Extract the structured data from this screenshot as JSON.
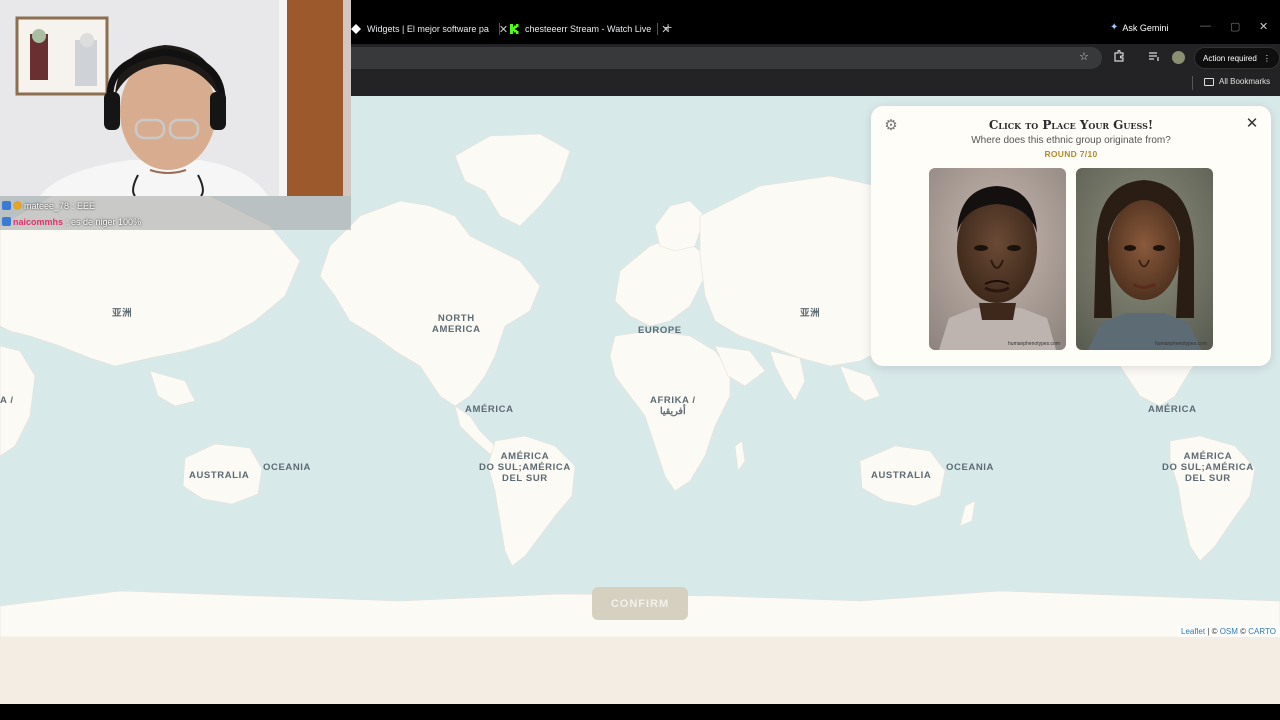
{
  "browser": {
    "tabs": [
      {
        "title": "Widgets | El mejor software pa",
        "favicon": "widgets-icon"
      },
      {
        "title": "chesteeerr Stream - Watch Live",
        "favicon": "kick-icon"
      }
    ],
    "new_tab": "+",
    "ask_gemini": "Ask Gemini",
    "action_required": "Action required",
    "all_bookmarks": "All Bookmarks",
    "colors": {
      "tabbar": "#000000",
      "toolbar": "#232325",
      "kick_green": "#53fc18"
    }
  },
  "game": {
    "card": {
      "title": "Click to Place Your Guess!",
      "subtitle": "Where does this ethnic group originate from?",
      "round": "ROUND 7/10",
      "close_label": "✕",
      "settings_icon": "gear-icon",
      "images": [
        {
          "name": "male-composite-face",
          "watermark": "humanphenotypes.com"
        },
        {
          "name": "female-composite-face",
          "watermark": "humanphenotypes.com"
        }
      ]
    },
    "confirm_label": "CONFIRM",
    "accent_color": "#b5892e"
  },
  "map": {
    "labels": [
      {
        "id": "asia-left",
        "text": "亚洲"
      },
      {
        "id": "north-america",
        "text": "NORTH\nAMERICA"
      },
      {
        "id": "europe",
        "text": "EUROPE"
      },
      {
        "id": "asia-right",
        "text": "亚洲"
      },
      {
        "id": "asia-edge",
        "text": "A /"
      },
      {
        "id": "america-1",
        "text": "AMÉRICA"
      },
      {
        "id": "africa",
        "text": "AFRIKA /\nأفريقيا"
      },
      {
        "id": "america-2",
        "text": "AMÉRICA"
      },
      {
        "id": "australia-1",
        "text": "AUSTRALIA"
      },
      {
        "id": "oceania-1",
        "text": "OCEANIA"
      },
      {
        "id": "south-america-1",
        "text": "AMÉRICA\nDO SUL;AMÉRICA\nDEL SUR"
      },
      {
        "id": "australia-2",
        "text": "AUSTRALIA"
      },
      {
        "id": "oceania-2",
        "text": "OCEANIA"
      },
      {
        "id": "south-america-2",
        "text": "AMÉRICA\nDO SUL;AMÉRICA\nDEL SUR"
      }
    ],
    "attribution": {
      "leaflet": "Leaflet",
      "sep": " | © ",
      "osm": "OSM",
      "sep2": " © ",
      "carto": "CARTO"
    },
    "colors": {
      "water": "#d8e9ea",
      "land": "#fbfaf5"
    }
  },
  "stream": {
    "chat": [
      {
        "user": "mateee_78",
        "message": ": EEE"
      },
      {
        "user": "naicommhs",
        "message": ": es de niger 100%"
      }
    ]
  }
}
